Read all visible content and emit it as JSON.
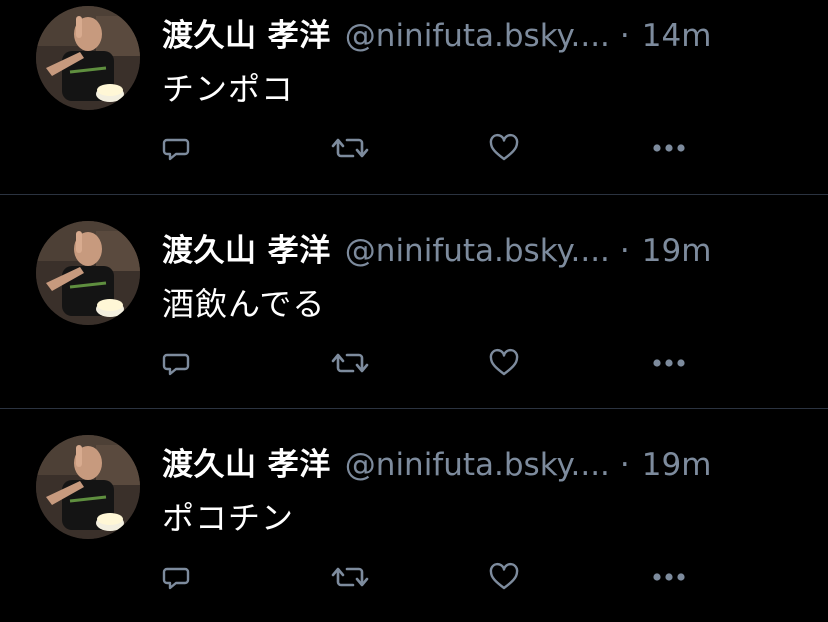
{
  "theme": {
    "background": "#000000",
    "text": "#ffffff",
    "muted": "#7d8b9d",
    "divider": "#2b3340"
  },
  "posts": [
    {
      "author_name": "渡久山 孝洋",
      "handle": "@ninifuta.bsky....",
      "separator": "·",
      "time": "14m",
      "text": "チンポコ"
    },
    {
      "author_name": "渡久山 孝洋",
      "handle": "@ninifuta.bsky....",
      "separator": "·",
      "time": "19m",
      "text": "酒飲んでる"
    },
    {
      "author_name": "渡久山 孝洋",
      "handle": "@ninifuta.bsky....",
      "separator": "·",
      "time": "19m",
      "text": "ポコチン"
    }
  ],
  "icons": {
    "avatar": "avatar-photo",
    "reply": "reply-icon",
    "repost": "repost-icon",
    "like": "heart-icon",
    "more": "more-icon"
  }
}
